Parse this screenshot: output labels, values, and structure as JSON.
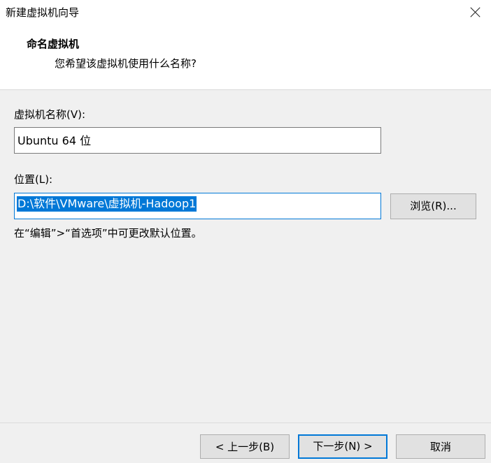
{
  "window": {
    "title": "新建虚拟机向导",
    "close_icon": "close-icon"
  },
  "header": {
    "heading": "命名虚拟机",
    "subheading": "您希望该虚拟机使用什么名称?"
  },
  "form": {
    "name_label": "虚拟机名称(V):",
    "name_value": "Ubuntu 64 位",
    "location_label": "位置(L):",
    "location_value": "D:\\软件\\VMware\\虚拟机-Hadoop1",
    "browse_label": "浏览(R)...",
    "hint": "在“编辑”>“首选项”中可更改默认位置。"
  },
  "footer": {
    "back_label": "< 上一步(B)",
    "next_label": "下一步(N) >",
    "cancel_label": "取消"
  },
  "colors": {
    "accent": "#0078d7",
    "panel": "#f0f0f0",
    "button": "#e1e1e1"
  }
}
